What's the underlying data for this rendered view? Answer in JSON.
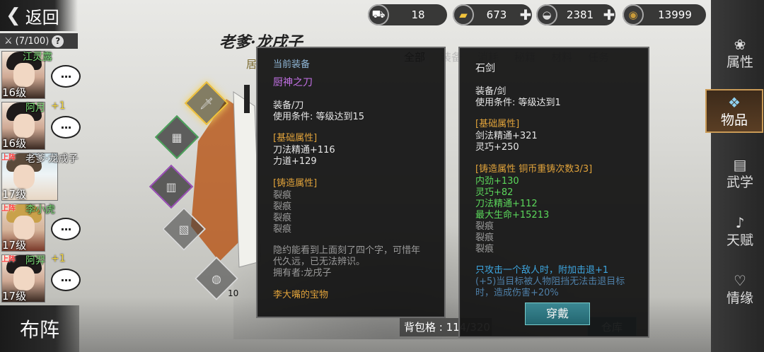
{
  "top_left": {
    "back_label": "返回",
    "team_count": "(7/100)",
    "help": "?"
  },
  "roster": [
    {
      "name": "江灵露",
      "level": "16级",
      "plus": "",
      "on_team": "",
      "name_color": "#7ee07a"
    },
    {
      "name": "阿月",
      "level": "16级",
      "plus": "+1",
      "on_team": "",
      "name_color": "#7ee07a"
    },
    {
      "name": "老爹·龙戌子",
      "level": "17级",
      "plus": "",
      "on_team": "上阵",
      "name_color": "#f4f4f4"
    },
    {
      "name": "李小虎",
      "level": "17级",
      "plus": "",
      "on_team": "上阵",
      "name_color": "#7ee07a"
    },
    {
      "name": "阿羿",
      "level": "17级",
      "plus": "+1",
      "on_team": "上阵",
      "name_color": "#7ee07a"
    }
  ],
  "chat_glyph": "···",
  "formation_label": "布阵",
  "character": {
    "name": "老爹·龙戌子",
    "subtitle": "居"
  },
  "slots": [
    {
      "name": "weapon-slot",
      "color": "gold"
    },
    {
      "name": "armor-slot",
      "color": "green"
    },
    {
      "name": "accessory-slot",
      "color": "purple"
    },
    {
      "name": "book-slot",
      "color": "plain"
    },
    {
      "name": "ring-slot",
      "color": "plain",
      "count": "10"
    }
  ],
  "resources": [
    {
      "icon": "cart-icon",
      "glyph": "⛟",
      "value": "18",
      "plus": false
    },
    {
      "icon": "gold-bar-icon",
      "glyph": "▰",
      "value": "673",
      "plus": true
    },
    {
      "icon": "silver-ingot-icon",
      "glyph": "◒",
      "value": "2381",
      "plus": true
    },
    {
      "icon": "coin-icon",
      "glyph": "◉",
      "value": "13999",
      "plus": false
    }
  ],
  "right_tabs": [
    {
      "name": "tab-attributes",
      "label": "属性",
      "glyph": "❀"
    },
    {
      "name": "tab-items",
      "label": "物品",
      "glyph": "❖",
      "active": true
    },
    {
      "name": "tab-martial",
      "label": "武学",
      "glyph": "▤"
    },
    {
      "name": "tab-talent",
      "label": "天赋",
      "glyph": "♪"
    },
    {
      "name": "tab-affection",
      "label": "情缘",
      "glyph": "♡"
    }
  ],
  "inventory": {
    "tabs": [
      "全部",
      "装备",
      "消耗",
      "秘籍",
      "材料",
      "任务"
    ],
    "bag_label": "背包格 : 114/320",
    "warehouse_label": "仓库"
  },
  "current_equip": {
    "header": "当前装备",
    "item_name": "厨神之刀",
    "type": "装备/刀",
    "requirement": "使用条件: 等级达到15",
    "base_header": "[基础属性]",
    "base_stats": [
      "刀法精通+116",
      "力道+129"
    ],
    "forge_header": "[铸造属性]",
    "forge_stats": [
      "裂痕",
      "裂痕",
      "裂痕",
      "裂痕"
    ],
    "description_1": "隐约能看到上面刻了四个字，可惜年",
    "description_2": "代久远，已无法辨识。",
    "owner": "拥有者:龙戌子",
    "set_name": "李大嘴的宝物"
  },
  "selected_item": {
    "item_name": "石剑",
    "type": "装备/剑",
    "requirement": "使用条件: 等级达到1",
    "base_header": "[基础属性]",
    "base_stats": [
      "剑法精通+321",
      "灵巧+250"
    ],
    "forge_header": "[铸造属性  铜币重铸次数3/3]",
    "forge_stats": [
      "内劲+130",
      "灵巧+82",
      "刀法精通+112",
      "最大生命+15213"
    ],
    "cracks": [
      "裂痕",
      "裂痕",
      "裂痕"
    ],
    "special_1": "只攻击一个敌人时，附加击退+1",
    "special_2": "(+5)当目标被人物阻挡无法击退目标",
    "special_3": "时，造成伤害+20%",
    "equip_button": "穿戴"
  },
  "colors": {
    "panel_bg": "#141414",
    "name_green": "#7ee07a",
    "forge_orange": "#e0a23a",
    "stat_green": "#5bd75b",
    "equip_button": "#2f7a84"
  }
}
